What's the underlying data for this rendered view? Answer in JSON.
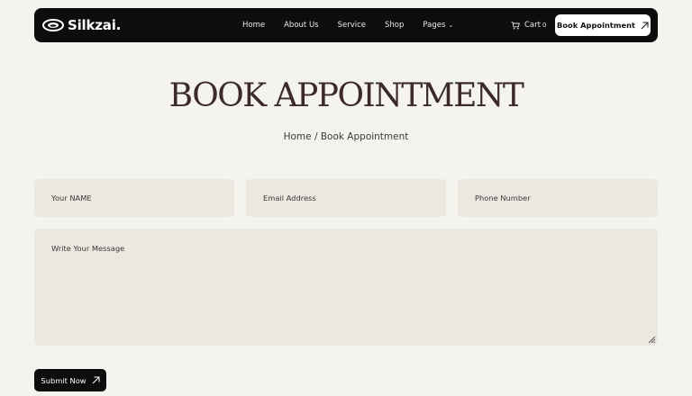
{
  "brand": {
    "name": "Silkzai."
  },
  "nav": {
    "links": [
      "Home",
      "About Us",
      "Service",
      "Shop",
      "Pages"
    ],
    "cart_label": "Cart",
    "cart_count": "0",
    "cta_label": "Book Appointment"
  },
  "hero": {
    "title": "BOOK APPOINTMENT",
    "breadcrumb": "Home / Book Appointment"
  },
  "form": {
    "name_placeholder": "Your NAME",
    "email_placeholder": "Email Address",
    "phone_placeholder": "Phone Number",
    "message_placeholder": "Write Your Message",
    "submit_label": "Submit Now"
  },
  "colors": {
    "background": "#f5f3ee",
    "nav_bg": "#0d0d0d",
    "field_bg": "#ebe8e0",
    "title": "#3b2a28"
  },
  "icons": [
    "logo-icon",
    "cart-icon",
    "chevron-down-icon",
    "arrow-up-right-icon",
    "resize-handle-icon"
  ]
}
